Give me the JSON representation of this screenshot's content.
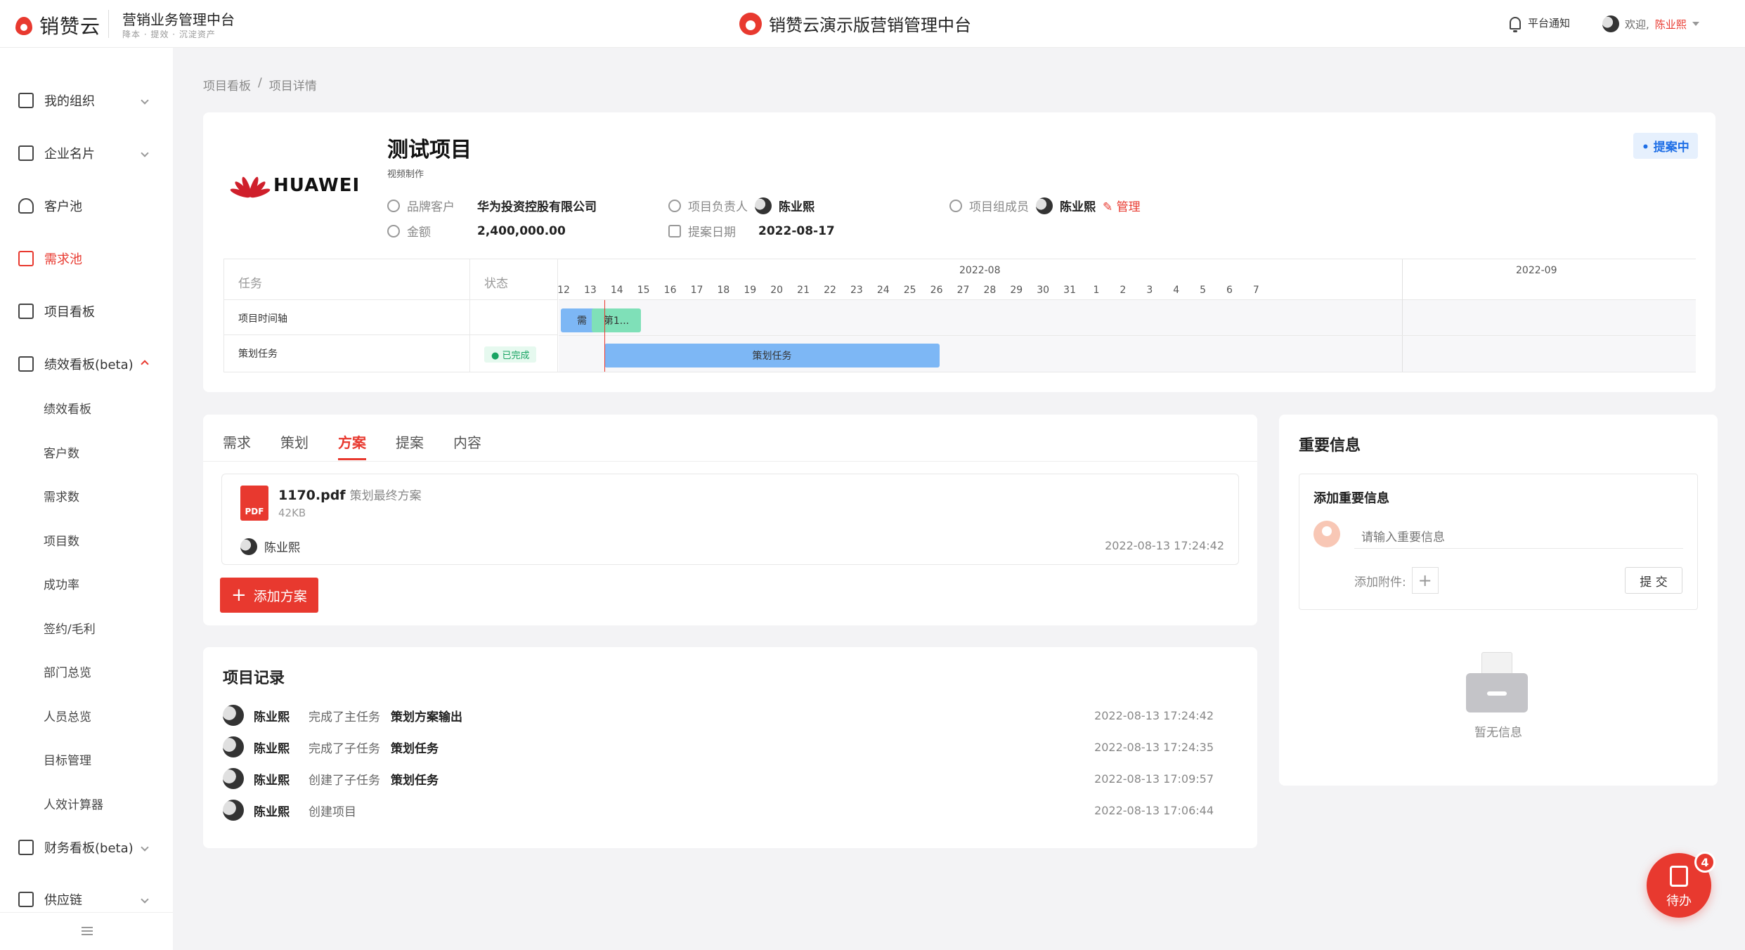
{
  "header": {
    "logo_text": "销赞云",
    "brand_title": "营销业务管理中台",
    "brand_sub": "降本 · 提效 · 沉淀资产",
    "center_title": "销赞云演示版营销管理中台",
    "notification_label": "平台通知",
    "welcome_label": "欢迎,",
    "user_name": "陈业熙"
  },
  "sidebar": {
    "items": [
      {
        "label": "我的组织"
      },
      {
        "label": "企业名片"
      },
      {
        "label": "客户池"
      },
      {
        "label": "需求池"
      },
      {
        "label": "项目看板"
      },
      {
        "label": "绩效看板(beta)"
      },
      {
        "label": "财务看板(beta)"
      },
      {
        "label": "供应链"
      }
    ],
    "sub_items": [
      "绩效看板",
      "客户数",
      "需求数",
      "项目数",
      "成功率",
      "签约/毛利",
      "部门总览",
      "人员总览",
      "目标管理",
      "人效计算器"
    ]
  },
  "breadcrumb": {
    "items": [
      "项目看板",
      "/",
      "项目详情"
    ]
  },
  "project": {
    "logo_text": "HUAWEI",
    "title": "测试项目",
    "tag": "视频制作",
    "status": "• 提案中",
    "brand_client_label": "品牌客户",
    "brand_client_value": "华为投资控股有限公司",
    "amount_label": "金额",
    "amount_value": "2,400,000.00",
    "owner_label": "项目负责人",
    "owner_value": "陈业熙",
    "date_label": "提案日期",
    "date_value": "2022-08-17",
    "members_label": "项目组成员",
    "members_value": "陈业熙",
    "manage_label": "管理"
  },
  "gantt": {
    "task_header": "任务",
    "status_header": "状态",
    "months": [
      "2022-08",
      "2022-09"
    ],
    "days_aug": [
      "12",
      "13",
      "14",
      "15",
      "16",
      "17",
      "18",
      "19",
      "20",
      "21",
      "22",
      "23",
      "24",
      "25",
      "26",
      "27",
      "28",
      "29",
      "30",
      "31"
    ],
    "days_sep": [
      "1",
      "2",
      "3",
      "4",
      "5",
      "6",
      "7"
    ],
    "rows": [
      {
        "task": "项目时间轴",
        "status": ""
      },
      {
        "task": "策划任务",
        "status": "● 已完成"
      }
    ],
    "bar_a_label": "需",
    "bar_b_label": "第1...",
    "bar_task_label": "策划任务"
  },
  "tabs": {
    "items": [
      "需求",
      "策划",
      "方案",
      "提案",
      "内容"
    ],
    "active": "方案"
  },
  "file": {
    "name": "1170.pdf",
    "note": "策划最终方案",
    "size": "42KB",
    "icon_text": "PDF",
    "user": "陈业熙",
    "time": "2022-08-13 17:24:42"
  },
  "add_button": "添加方案",
  "records": {
    "title": "项目记录",
    "items": [
      {
        "name": "陈业熙",
        "action": "完成了主任务",
        "target": "策划方案输出",
        "time": "2022-08-13 17:24:42"
      },
      {
        "name": "陈业熙",
        "action": "完成了子任务",
        "target": "策划任务",
        "time": "2022-08-13 17:24:35"
      },
      {
        "name": "陈业熙",
        "action": "创建了子任务",
        "target": "策划任务",
        "time": "2022-08-13 17:09:57"
      },
      {
        "name": "陈业熙",
        "action": "创建项目",
        "target": "",
        "time": "2022-08-13 17:06:44"
      }
    ]
  },
  "important": {
    "title": "重要信息",
    "box_title": "添加重要信息",
    "placeholder": "请输入重要信息",
    "attach_label": "添加附件:",
    "submit_label": "提 交",
    "empty_text": "暂无信息"
  },
  "todo": {
    "label": "待办",
    "count": "4"
  },
  "colors": {
    "accent": "#e8392f",
    "status_blue": "#1f6fe6",
    "done_green": "#19a463",
    "bar_blue": "#7db7f5",
    "bar_green": "#7fe0b8"
  }
}
